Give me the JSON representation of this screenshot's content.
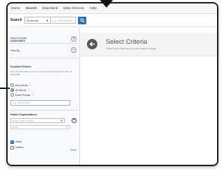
{
  "menu": [
    "Home",
    "Search",
    "Data Bank",
    "Data Services",
    "Help"
  ],
  "menu_active_index": 1,
  "search": {
    "label": "Search",
    "scope": "All Words",
    "placeholder": "e.g. 1000001821"
  },
  "sidebar": {
    "select_domain_label": "Select Domain",
    "select_domain_value": "ASSIGNEES",
    "filter_label": "Filter By",
    "keyword_title": "Keyword Search",
    "keyword_info_prefix": "For more information on how to use and search keywords, visit our",
    "keyword_info_link": "help guide",
    "radio_any": "Any Words",
    "radio_all": "All Words",
    "radio_exact": "Exact Phrase",
    "radio_selected": "All Words",
    "keyword_placeholder": "e.g. 1000001821",
    "org_title": "Patent Organizations",
    "org_placeholder": "Enter Code or Name",
    "tag_placeholder": "None",
    "check_active": "Active",
    "check_inactive": "Inactive",
    "active_checked": true,
    "inactive_checked": false,
    "reset_label": "Reset"
  },
  "main": {
    "title": "Select Criteria",
    "subtitle": "Choose your filters and run your search to begin."
  },
  "colors": {
    "accent": "#2f6db5",
    "radio_selected": "#2e7d32",
    "hero_background": "#f3f3f3"
  }
}
